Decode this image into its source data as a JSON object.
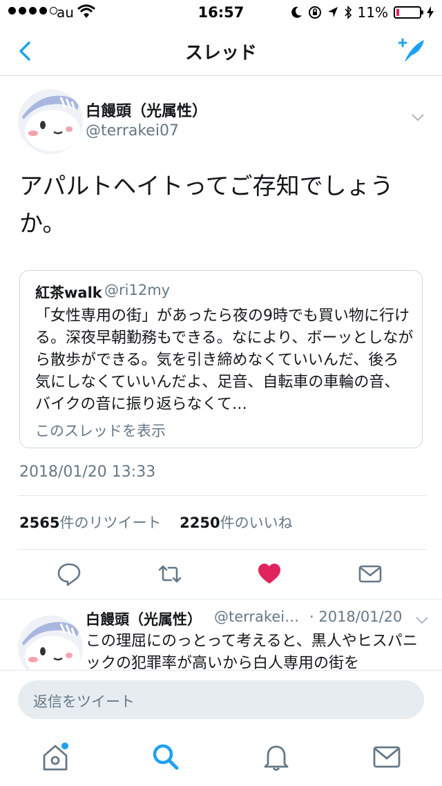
{
  "status": {
    "carrier": "au",
    "time": "16:57",
    "battery": "11%"
  },
  "nav": {
    "title": "スレッド"
  },
  "tweet": {
    "name": "白饅頭（光属性）",
    "handle": "@terrakei07",
    "text": "アパルトヘイトってご存知でしょうか。",
    "date": "2018/01/20 13:33",
    "retweets": "2565",
    "retweets_label": "件のリツイート",
    "likes": "2250",
    "likes_label": "件のいいね"
  },
  "quote": {
    "name": "紅茶walk",
    "handle": "@ri12my",
    "text": "「女性専用の街」があったら夜の9時でも買い物に行ける。深夜早朝勤務もできる。なにより、ボーッとしながら散歩ができる。気を引き締めなくていいんだ、後ろ気にしなくていいんだよ、足音、自転車の車輪の音、バイクの音に振り返らなくて…",
    "link": "このスレッドを表示"
  },
  "reply": {
    "name": "白饅頭（光属性）",
    "handle": "@terrakei…",
    "date": "· 2018/01/20",
    "text": "この理屈にのっとって考えると、黒人やヒスパニックの犯罪率が高いから白人専用の街を"
  },
  "composer": {
    "placeholder": "返信をツイート"
  },
  "colors": {
    "accent": "#1da1f2",
    "like": "#e0245e",
    "muted": "#657786"
  },
  "icons": [
    "back-icon",
    "compose-icon",
    "chevron-down-icon",
    "reply-icon",
    "retweet-icon",
    "like-icon",
    "message-icon",
    "home-icon",
    "search-icon",
    "notifications-icon"
  ]
}
